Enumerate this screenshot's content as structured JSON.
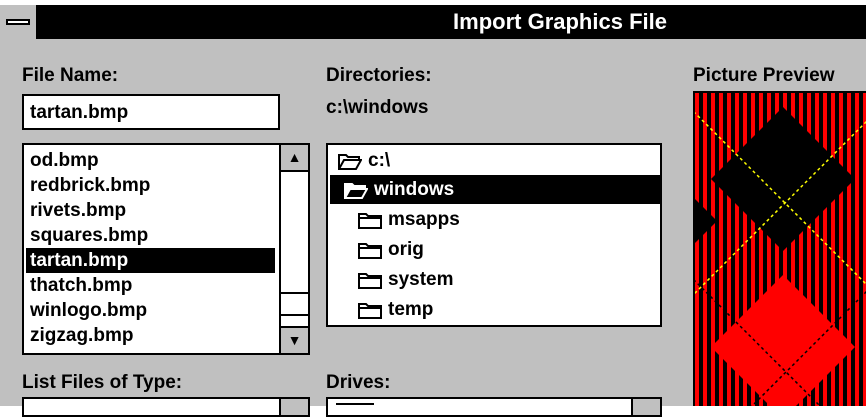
{
  "window": {
    "title": "Import Graphics File"
  },
  "file_name": {
    "label": "File Name:",
    "value": "tartan.bmp"
  },
  "files": {
    "items": [
      "od.bmp",
      "redbrick.bmp",
      "rivets.bmp",
      "squares.bmp",
      "tartan.bmp",
      "thatch.bmp",
      "winlogo.bmp",
      "zigzag.bmp"
    ],
    "selected": "tartan.bmp"
  },
  "directories": {
    "label": "Directories:",
    "current_path": "c:\\windows",
    "tree": [
      {
        "name": "c:\\",
        "icon": "folder-open-icon"
      },
      {
        "name": "windows",
        "icon": "folder-open-icon",
        "selected": true
      },
      {
        "name": "msapps",
        "icon": "folder-icon"
      },
      {
        "name": "orig",
        "icon": "folder-icon"
      },
      {
        "name": "system",
        "icon": "folder-icon"
      },
      {
        "name": "temp",
        "icon": "folder-icon"
      }
    ]
  },
  "list_files_of_type": {
    "label": "List Files of Type:"
  },
  "drives": {
    "label": "Drives:"
  },
  "preview": {
    "label": "Picture Preview"
  },
  "colors": {
    "titlebar": "#000000",
    "dialog_bg": "#c0c0c0",
    "tartan_red": "#ff0000",
    "tartan_black": "#000000",
    "tartan_line": "#ffff00"
  }
}
